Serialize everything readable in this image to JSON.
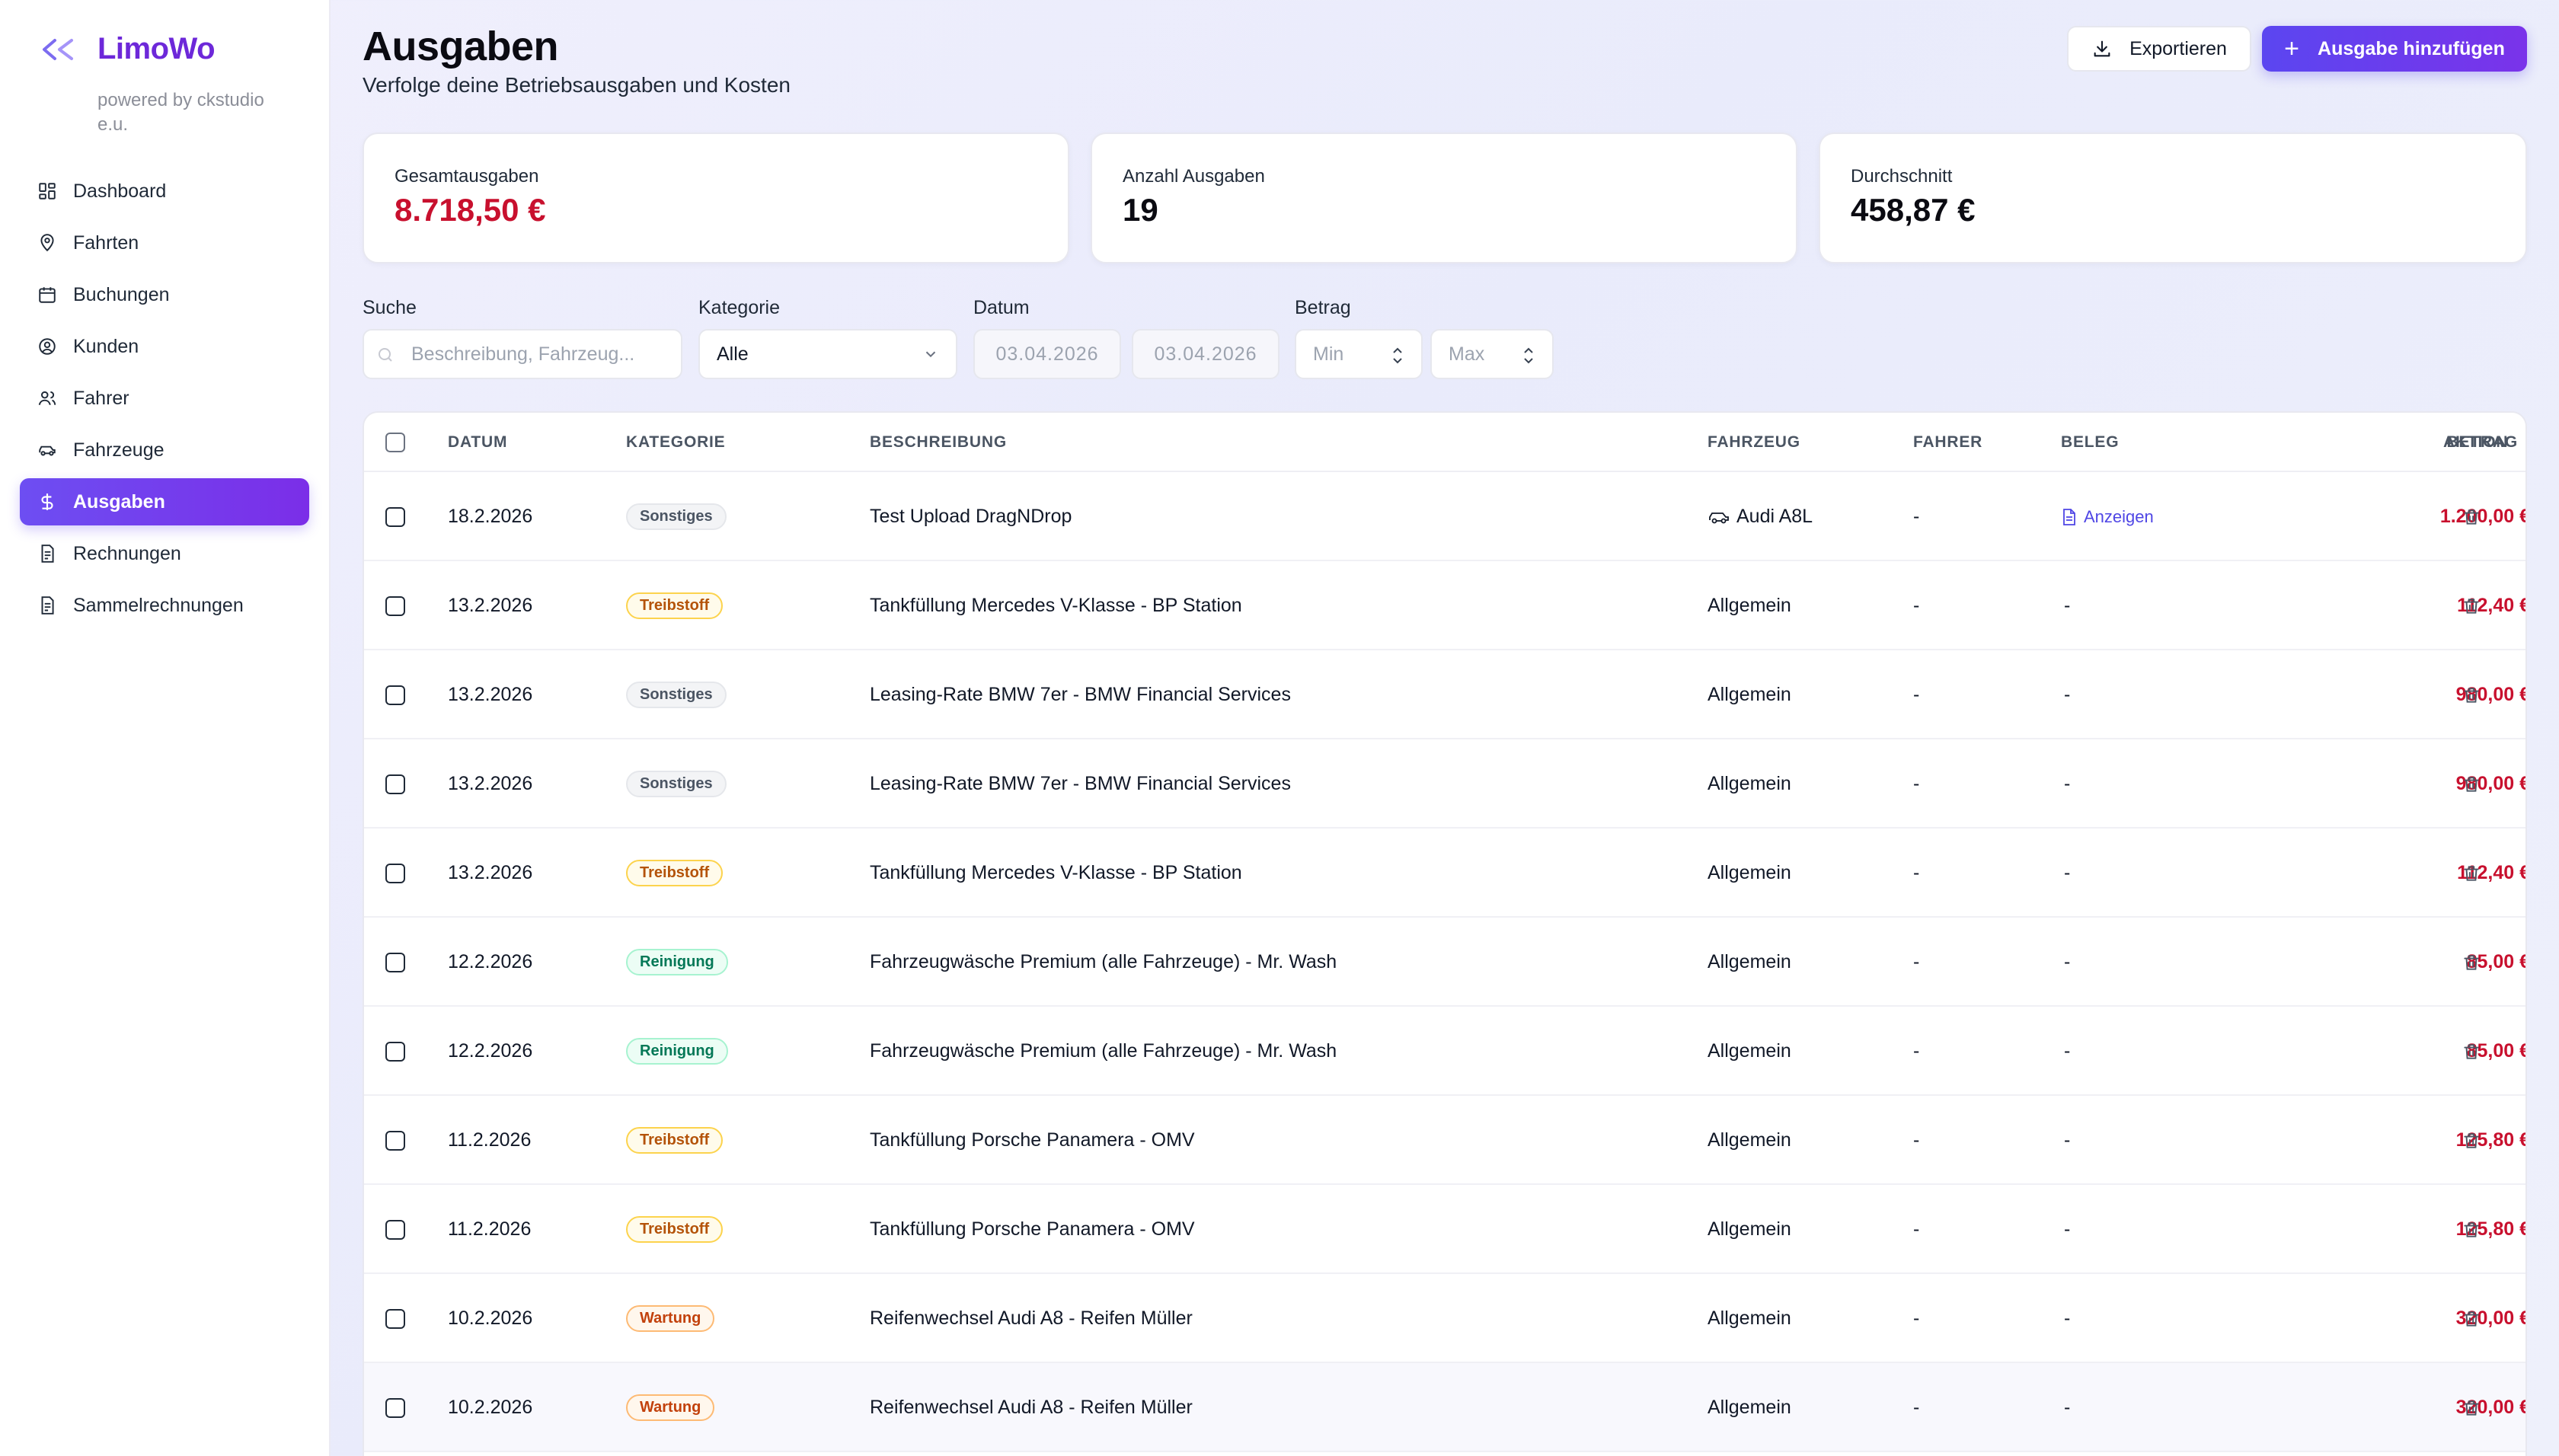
{
  "brand": {
    "name": "LimoWo",
    "subtitle": "powered by ckstudio e.u.",
    "accent": "#6d28d9"
  },
  "sidebar": {
    "items": [
      {
        "label": "Dashboard",
        "icon": "dashboard-icon",
        "active": false
      },
      {
        "label": "Fahrten",
        "icon": "map-pin-icon",
        "active": false
      },
      {
        "label": "Buchungen",
        "icon": "calendar-icon",
        "active": false
      },
      {
        "label": "Kunden",
        "icon": "user-circle-icon",
        "active": false
      },
      {
        "label": "Fahrer",
        "icon": "users-icon",
        "active": false
      },
      {
        "label": "Fahrzeuge",
        "icon": "car-icon",
        "active": false
      },
      {
        "label": "Ausgaben",
        "icon": "dollar-icon",
        "active": true
      },
      {
        "label": "Rechnungen",
        "icon": "invoice-icon",
        "active": false
      },
      {
        "label": "Sammelrechnungen",
        "icon": "invoice-stack-icon",
        "active": false
      }
    ]
  },
  "header": {
    "title": "Ausgaben",
    "subtitle": "Verfolge deine Betriebsausgaben und Kosten",
    "export_label": "Exportieren",
    "add_label": "Ausgabe hinzufügen"
  },
  "stats": [
    {
      "label": "Gesamtausgaben",
      "value": "8.718,50 €",
      "color": "#c8102e"
    },
    {
      "label": "Anzahl Ausgaben",
      "value": "19",
      "color": "#0b0b12"
    },
    {
      "label": "Durchschnitt",
      "value": "458,87 €",
      "color": "#0b0b12"
    }
  ],
  "filters": {
    "search_label": "Suche",
    "search_placeholder": "Beschreibung, Fahrzeug...",
    "category_label": "Kategorie",
    "category_value": "Alle",
    "date_label": "Datum",
    "date_from": "03.04.2026",
    "date_to": "03.04.2026",
    "amount_label": "Betrag",
    "amount_min_placeholder": "Min",
    "amount_max_placeholder": "Max"
  },
  "table": {
    "columns": [
      "DATUM",
      "KATEGORIE",
      "BESCHREIBUNG",
      "FAHRZEUG",
      "FAHRER",
      "BELEG",
      "BETRAG",
      "AKTION"
    ],
    "rows": [
      {
        "date": "18.2.2026",
        "category": "Sonstiges",
        "description": "Test Upload DragNDrop",
        "vehicle": "Audi A8L",
        "vehicle_icon": true,
        "driver": "-",
        "receipt": "Anzeigen",
        "amount": "1.200,00 €"
      },
      {
        "date": "13.2.2026",
        "category": "Treibstoff",
        "description": "Tankfüllung Mercedes V-Klasse - BP Station",
        "vehicle": "Allgemein",
        "vehicle_icon": false,
        "driver": "-",
        "receipt": "-",
        "amount": "112,40 €"
      },
      {
        "date": "13.2.2026",
        "category": "Sonstiges",
        "description": "Leasing-Rate BMW 7er - BMW Financial Services",
        "vehicle": "Allgemein",
        "vehicle_icon": false,
        "driver": "-",
        "receipt": "-",
        "amount": "980,00 €"
      },
      {
        "date": "13.2.2026",
        "category": "Sonstiges",
        "description": "Leasing-Rate BMW 7er - BMW Financial Services",
        "vehicle": "Allgemein",
        "vehicle_icon": false,
        "driver": "-",
        "receipt": "-",
        "amount": "980,00 €"
      },
      {
        "date": "13.2.2026",
        "category": "Treibstoff",
        "description": "Tankfüllung Mercedes V-Klasse - BP Station",
        "vehicle": "Allgemein",
        "vehicle_icon": false,
        "driver": "-",
        "receipt": "-",
        "amount": "112,40 €"
      },
      {
        "date": "12.2.2026",
        "category": "Reinigung",
        "description": "Fahrzeugwäsche Premium (alle Fahrzeuge) - Mr. Wash",
        "vehicle": "Allgemein",
        "vehicle_icon": false,
        "driver": "-",
        "receipt": "-",
        "amount": "85,00 €"
      },
      {
        "date": "12.2.2026",
        "category": "Reinigung",
        "description": "Fahrzeugwäsche Premium (alle Fahrzeuge) - Mr. Wash",
        "vehicle": "Allgemein",
        "vehicle_icon": false,
        "driver": "-",
        "receipt": "-",
        "amount": "85,00 €"
      },
      {
        "date": "11.2.2026",
        "category": "Treibstoff",
        "description": "Tankfüllung Porsche Panamera - OMV",
        "vehicle": "Allgemein",
        "vehicle_icon": false,
        "driver": "-",
        "receipt": "-",
        "amount": "125,80 €"
      },
      {
        "date": "11.2.2026",
        "category": "Treibstoff",
        "description": "Tankfüllung Porsche Panamera - OMV",
        "vehicle": "Allgemein",
        "vehicle_icon": false,
        "driver": "-",
        "receipt": "-",
        "amount": "125,80 €"
      },
      {
        "date": "10.2.2026",
        "category": "Wartung",
        "description": "Reifenwechsel Audi A8 - Reifen Müller",
        "vehicle": "Allgemein",
        "vehicle_icon": false,
        "driver": "-",
        "receipt": "-",
        "amount": "320,00 €"
      },
      {
        "date": "10.2.2026",
        "category": "Wartung",
        "description": "Reifenwechsel Audi A8 - Reifen Müller",
        "vehicle": "Allgemein",
        "vehicle_icon": false,
        "driver": "-",
        "receipt": "-",
        "amount": "320,00 €"
      }
    ]
  },
  "colors": {
    "accent": "#6d4ef2",
    "amount": "#c8102e",
    "link": "#4f46e5"
  }
}
